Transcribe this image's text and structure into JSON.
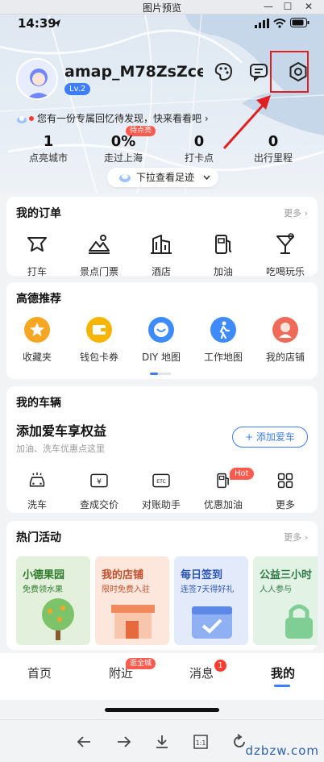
{
  "window": {
    "title": "图片预览",
    "controls": [
      "—",
      "☐",
      "✕"
    ]
  },
  "status_bar": {
    "time": "14:39"
  },
  "profile": {
    "username": "amap_M78ZsZce...",
    "level": "Lv.2"
  },
  "memory_banner": {
    "text": "您有一份专属回忆待发现，快来看看吧 ›"
  },
  "stats": [
    {
      "value": "1",
      "label": "点亮城市"
    },
    {
      "value": "0%",
      "label": "走过上海",
      "badge": "待点亮"
    },
    {
      "value": "0",
      "label": "打卡点"
    },
    {
      "value": "0",
      "label": "出行里程"
    }
  ],
  "footprint_pill": {
    "label": "下拉查看足迹"
  },
  "orders": {
    "title": "我的订单",
    "more": "更多 ›",
    "items": [
      {
        "label": "打车",
        "icon": "taxi-icon"
      },
      {
        "label": "景点门票",
        "icon": "scenic-ticket-icon"
      },
      {
        "label": "酒店",
        "icon": "hotel-icon"
      },
      {
        "label": "加油",
        "icon": "fuel-icon"
      },
      {
        "label": "吃喝玩乐",
        "icon": "cocktail-icon"
      }
    ]
  },
  "recommend": {
    "title": "高德推荐",
    "items": [
      {
        "label": "收藏夹",
        "icon": "star-icon",
        "color": "#f5a623"
      },
      {
        "label": "钱包卡券",
        "icon": "wallet-icon",
        "color": "#f7b500"
      },
      {
        "label": "DIY 地图",
        "icon": "smile-map-icon",
        "color": "#3d8bfd"
      },
      {
        "label": "工作地图",
        "icon": "walker-icon",
        "color": "#3d8bfd"
      },
      {
        "label": "我的店铺",
        "icon": "shop-icon",
        "color": "#f06a5a"
      }
    ]
  },
  "vehicle": {
    "title": "我的车辆",
    "headline": "添加爱车享权益",
    "sub": "加油、洗车优惠点这里",
    "add_button": "+ 添加爱车",
    "items": [
      {
        "label": "洗车",
        "icon": "car-wash-icon"
      },
      {
        "label": "查成交价",
        "icon": "price-tag-icon"
      },
      {
        "label": "对账助手",
        "icon": "etc-icon"
      },
      {
        "label": "优惠加油",
        "icon": "fuel-discount-icon",
        "badge": "Hot"
      },
      {
        "label": "更多",
        "icon": "grid-more-icon"
      }
    ]
  },
  "activities": {
    "title": "热门活动",
    "more": "更多 ›",
    "items": [
      {
        "title": "小德果园",
        "sub": "免费领水果",
        "bg": "#e3f1dc",
        "color": "#2f7a2a"
      },
      {
        "title": "我的店铺",
        "sub": "限时免费入驻",
        "bg": "#fde7dc",
        "color": "#c2502d"
      },
      {
        "title": "每日签到",
        "sub": "连签7天得好礼",
        "bg": "#e3ebfb",
        "color": "#2c55b8"
      },
      {
        "title": "公益三小时",
        "sub": "人人参与",
        "bg": "#e2f3e6",
        "color": "#2f7a45"
      }
    ]
  },
  "tabbar": {
    "items": [
      {
        "label": "首页"
      },
      {
        "label": "附近",
        "badge": "逛全城"
      },
      {
        "label": "消息",
        "badge": "1"
      },
      {
        "label": "我的",
        "active": true
      }
    ]
  },
  "watermark": "dzbzw.com",
  "colors": {
    "accent": "#3d7dff",
    "highlight_box": "#e02020",
    "badge": "#ff5a4e"
  }
}
